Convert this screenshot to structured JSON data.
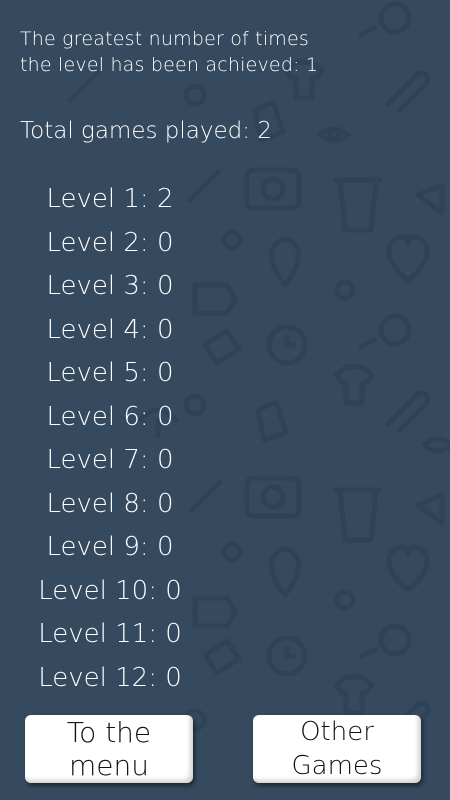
{
  "stats": {
    "greatest_text": "The greatest number of times the level has been achieved: 1",
    "total_text": "Total games played: 2"
  },
  "levels": [
    "Level 1: 2",
    "Level 2: 0",
    "Level 3: 0",
    "Level 4: 0",
    "Level 5: 0",
    "Level 6: 0",
    "Level 7: 0",
    "Level 8: 0",
    "Level 9: 0",
    "Level 10: 0",
    "Level 11: 0",
    "Level 12: 0"
  ],
  "buttons": {
    "menu_label": "To the menu",
    "other_label_line1": "Other",
    "other_label_line2": "Games"
  },
  "colors": {
    "background": "#354a5f",
    "pattern": "#2f4254",
    "button": "#ffffff"
  }
}
